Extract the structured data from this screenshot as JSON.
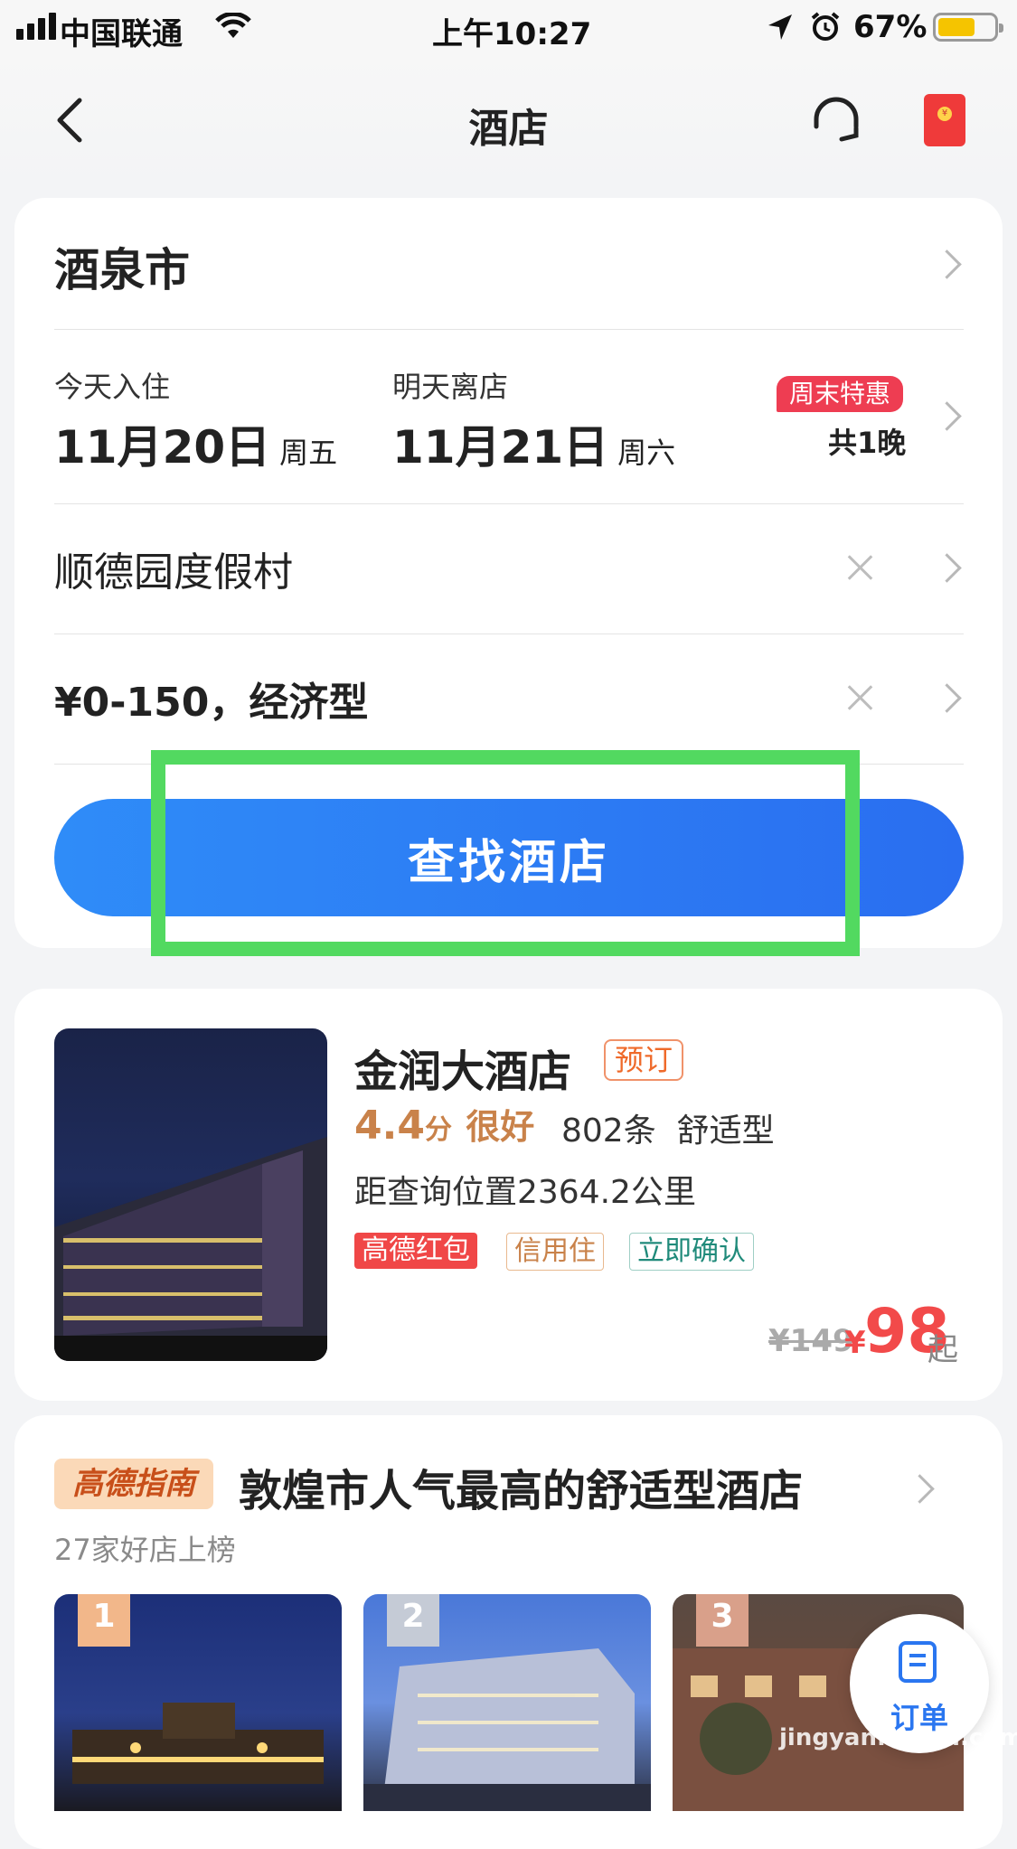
{
  "status_bar": {
    "carrier": "中国联通",
    "time": "上午10:27",
    "battery": "67%",
    "battery_level": 0.67,
    "icons": [
      "signal-icon",
      "wifi-icon",
      "location-arrow-icon",
      "alarm-icon",
      "battery-icon"
    ]
  },
  "header": {
    "title": "酒店",
    "icons": [
      "back-icon",
      "customer-service-icon",
      "red-packet-icon"
    ]
  },
  "search": {
    "city": "酒泉市",
    "checkin_label": "今天入住",
    "checkin_date": "11月20日",
    "checkin_weekday": "周五",
    "checkout_label": "明天离店",
    "checkout_date": "11月21日",
    "checkout_weekday": "周六",
    "promo_badge": "周末特惠",
    "nights": "共1晚",
    "keyword": "顺德园度假村",
    "price_filter": "¥0-150，经济型",
    "button": "查找酒店"
  },
  "hotel": {
    "name": "金润大酒店",
    "book_tag": "预订",
    "score": "4.4",
    "score_unit": "分",
    "rating_word": "很好",
    "reviews": "802条",
    "type": "舒适型",
    "distance": "距查询位置2364.2公里",
    "tags": [
      {
        "text": "高德红包",
        "color": "#f04747"
      },
      {
        "text": "信用住",
        "color": "#c9824a"
      },
      {
        "text": "立即确认",
        "color": "#1f8a7a"
      }
    ],
    "price_old": "¥149",
    "price_symbol": "¥",
    "price_new": "98",
    "price_suffix": "起"
  },
  "ranking": {
    "badge": "高德指南",
    "title": "敦煌市人气最高的舒适型酒店",
    "subtitle": "27家好店上榜",
    "items": [
      {
        "rank": "1"
      },
      {
        "rank": "2"
      },
      {
        "rank": "3"
      }
    ]
  },
  "float_order": {
    "label": "订单"
  },
  "watermark": {
    "text": "jingyan.baidu.com"
  },
  "colors": {
    "accent": "#2a6ef0",
    "highlight": "#52d960",
    "price": "#f24a4a",
    "promo": "#ee3d52"
  }
}
